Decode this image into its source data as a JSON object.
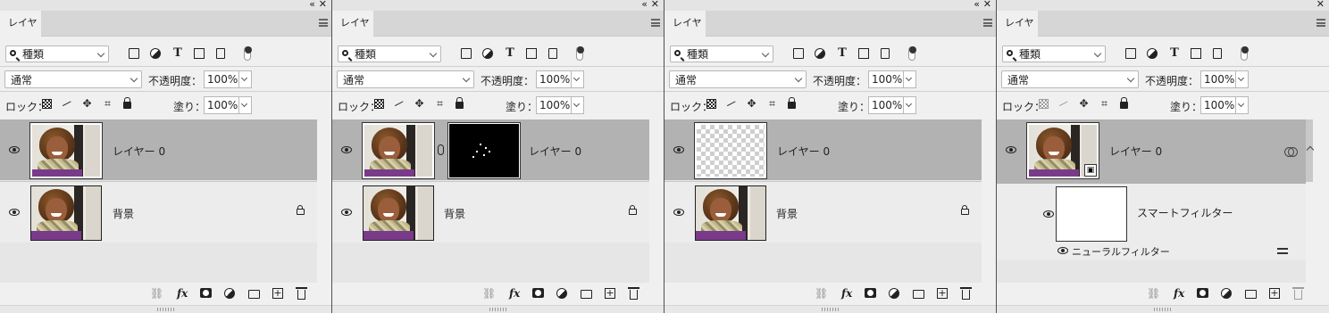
{
  "tab_label": "レイヤー",
  "filter_kind": "種類",
  "blend_mode": "通常",
  "opacity_label": "不透明度：",
  "opacity_value": "100%",
  "lock_label": "ロック：",
  "fill_label": "塗り：",
  "fill_value": "100%",
  "panels": [
    {
      "layers": [
        {
          "name": "レイヤー 0",
          "selected": true
        },
        {
          "name": "背景",
          "locked": true
        }
      ]
    },
    {
      "layers": [
        {
          "name": "レイヤー 0",
          "selected": true,
          "has_mask": true
        },
        {
          "name": "背景",
          "locked": true
        }
      ]
    },
    {
      "layers": [
        {
          "name": "レイヤー 0",
          "selected": true,
          "transparent": true
        },
        {
          "name": "背景",
          "locked": true
        }
      ]
    },
    {
      "layers": [
        {
          "name": "レイヤー 0",
          "selected": true,
          "smart_object": true
        }
      ],
      "smart_filters_label": "スマートフィルター",
      "neural_filter_label": "ニューラルフィルター"
    }
  ]
}
